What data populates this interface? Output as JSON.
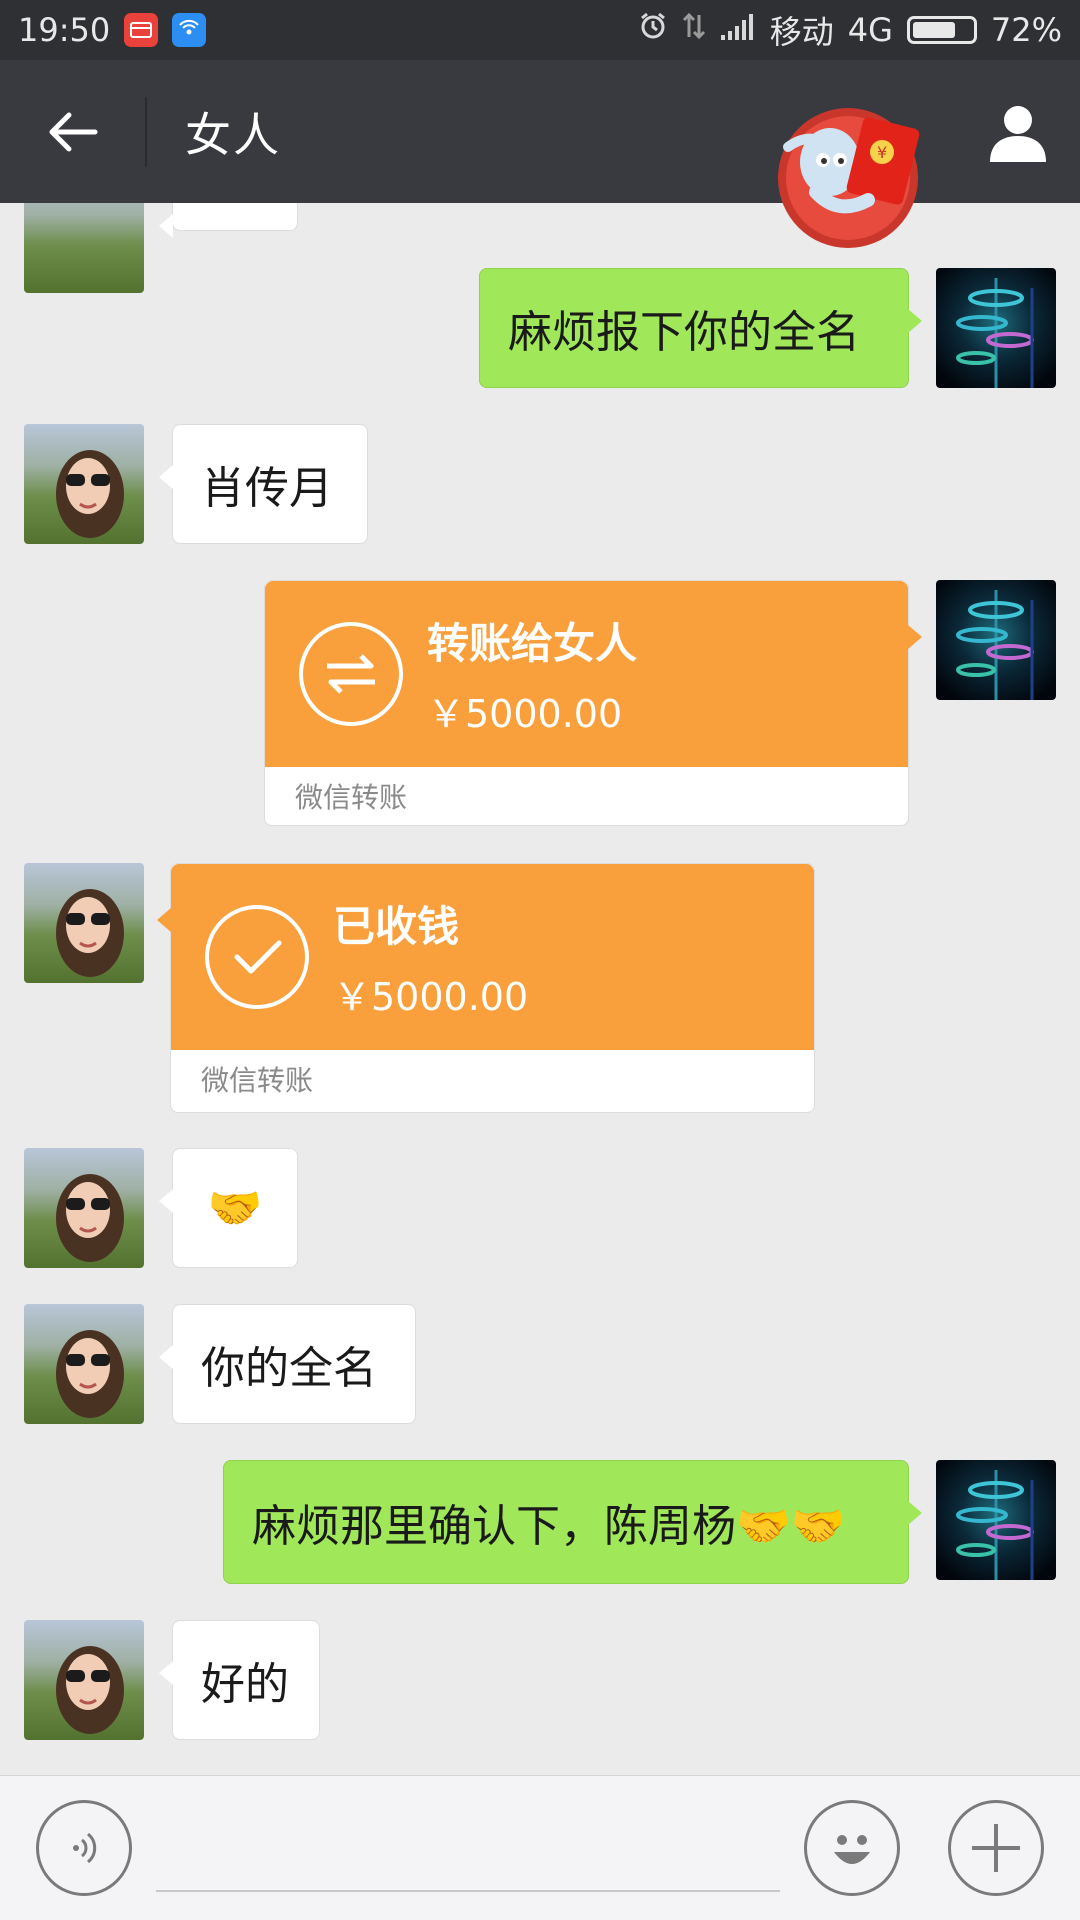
{
  "status_bar": {
    "time": "19:50",
    "carrier": "移动",
    "network": "4G",
    "battery": "72%",
    "battery_level": 0.72,
    "icons": [
      "red-card-icon",
      "wifi-app-icon",
      "alarm-icon",
      "data-arrows-icon",
      "signal-icon"
    ]
  },
  "header": {
    "title": "女人",
    "back_icon": "arrow-left-icon",
    "contact_icon": "person-icon",
    "mascot_icon": "red-packet-mascot-icon"
  },
  "messages": [
    {
      "side": "right",
      "type": "text",
      "text": "麻烦报下你的全名"
    },
    {
      "side": "left",
      "type": "text",
      "text": "肖传月"
    },
    {
      "side": "right",
      "type": "transfer",
      "title": "转账给女人",
      "amount": "￥5000.00",
      "footer": "微信转账",
      "icon": "transfer-arrows-icon"
    },
    {
      "side": "left",
      "type": "transfer",
      "title": "已收钱",
      "amount": "￥5000.00",
      "footer": "微信转账",
      "icon": "check-icon"
    },
    {
      "side": "left",
      "type": "emoji",
      "text": "🤝"
    },
    {
      "side": "left",
      "type": "text",
      "text": "你的全名"
    },
    {
      "side": "right",
      "type": "text",
      "text": "麻烦那里确认下，陈周杨🤝🤝"
    },
    {
      "side": "left",
      "type": "text",
      "text": "好的"
    }
  ],
  "input_bar": {
    "value": "",
    "voice_icon": "voice-icon",
    "emoji_icon": "smiley-icon",
    "plus_icon": "plus-icon"
  },
  "colors": {
    "header_bg": "#393a3f",
    "status_bg": "#2e3034",
    "chat_bg": "#ebebeb",
    "green_bubble": "#a0e75a",
    "transfer_orange": "#f99f3b"
  }
}
